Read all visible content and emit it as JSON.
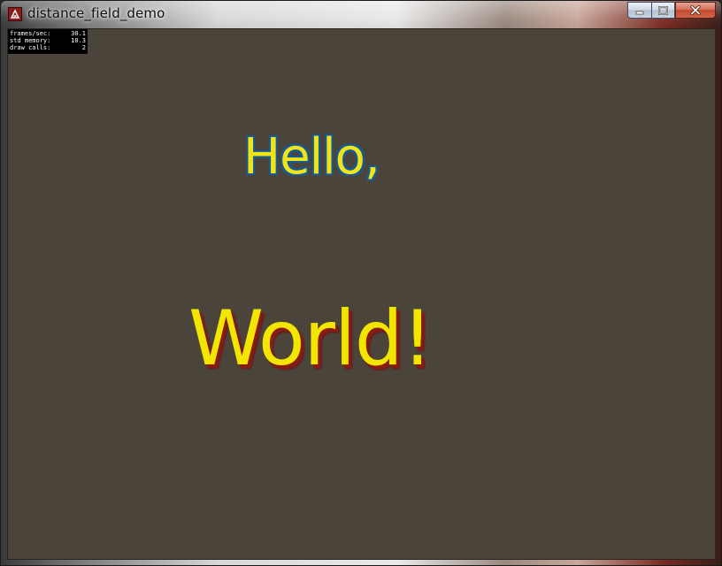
{
  "window": {
    "title": "distance_field_demo",
    "controls": {
      "minimize": "minimize",
      "maximize": "maximize",
      "close": "close"
    }
  },
  "stats": [
    {
      "label": "frames/sec:",
      "value": "30.1"
    },
    {
      "label": "std memory:",
      "value": "10.3"
    },
    {
      "label": "draw calls:",
      "value": "2"
    }
  ],
  "canvas": {
    "background": "#4b443b",
    "hello_text": "Hello,",
    "hello_color": "#f0e414",
    "hello_outline_color": "#135a9a",
    "world_text": "World!",
    "world_color": "#f2e600",
    "world_shadow_color": "#8a1a14"
  }
}
